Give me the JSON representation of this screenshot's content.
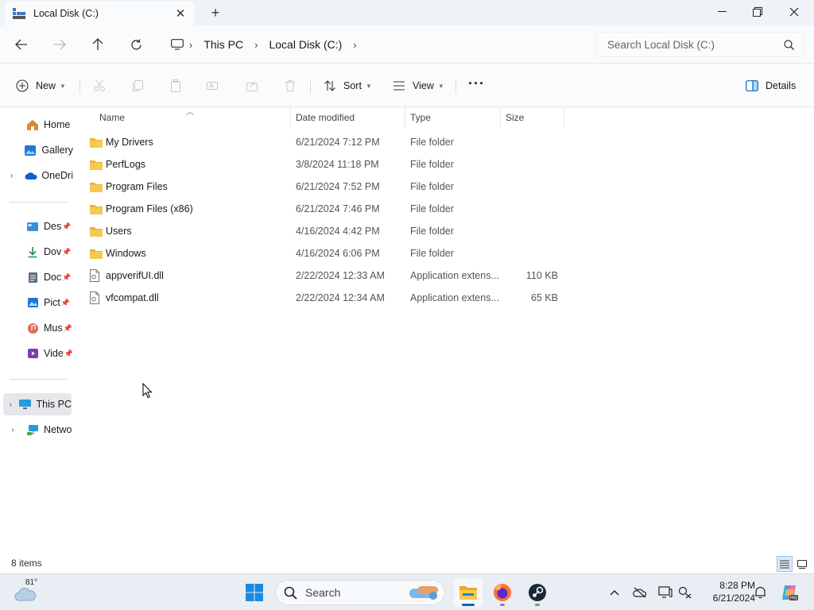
{
  "window": {
    "tab_title": "Local Disk (C:)",
    "new_tab_symbol": "+"
  },
  "address": {
    "crumbs": [
      "This PC",
      "Local Disk (C:)"
    ],
    "search_placeholder": "Search Local Disk (C:)"
  },
  "commands": {
    "new_label": "New",
    "sort_label": "Sort",
    "view_label": "View",
    "more_label": "···",
    "details_label": "Details"
  },
  "nav": {
    "items": [
      {
        "label": "Home",
        "icon": "home-icon"
      },
      {
        "label": "Gallery",
        "icon": "gallery-icon"
      },
      {
        "label": "OneDri",
        "icon": "onedrive-icon"
      },
      {
        "label": "Des",
        "icon": "desktop-icon"
      },
      {
        "label": "Dov",
        "icon": "downloads-icon"
      },
      {
        "label": "Doc",
        "icon": "documents-icon"
      },
      {
        "label": "Pict",
        "icon": "pictures-icon"
      },
      {
        "label": "Mus",
        "icon": "music-icon"
      },
      {
        "label": "Vide",
        "icon": "videos-icon"
      },
      {
        "label": "This PC",
        "icon": "this-pc-icon"
      },
      {
        "label": "Netwo",
        "icon": "network-icon"
      }
    ]
  },
  "columns": {
    "name": "Name",
    "date": "Date modified",
    "type": "Type",
    "size": "Size"
  },
  "files": [
    {
      "name": "My Drivers",
      "date": "6/21/2024 7:12 PM",
      "type": "File folder",
      "size": "",
      "kind": "folder"
    },
    {
      "name": "PerfLogs",
      "date": "3/8/2024 11:18 PM",
      "type": "File folder",
      "size": "",
      "kind": "folder"
    },
    {
      "name": "Program Files",
      "date": "6/21/2024 7:52 PM",
      "type": "File folder",
      "size": "",
      "kind": "folder"
    },
    {
      "name": "Program Files (x86)",
      "date": "6/21/2024 7:46 PM",
      "type": "File folder",
      "size": "",
      "kind": "folder"
    },
    {
      "name": "Users",
      "date": "4/16/2024 4:42 PM",
      "type": "File folder",
      "size": "",
      "kind": "folder"
    },
    {
      "name": "Windows",
      "date": "4/16/2024 6:06 PM",
      "type": "File folder",
      "size": "",
      "kind": "folder"
    },
    {
      "name": "appverifUI.dll",
      "date": "2/22/2024 12:33 AM",
      "type": "Application extens...",
      "size": "110 KB",
      "kind": "dll"
    },
    {
      "name": "vfcompat.dll",
      "date": "2/22/2024 12:34 AM",
      "type": "Application extens...",
      "size": "65 KB",
      "kind": "dll"
    }
  ],
  "status": {
    "item_count": "8 items"
  },
  "taskbar": {
    "temperature": "81°",
    "search_label": "Search",
    "time": "8:28 PM",
    "date": "6/21/2024"
  },
  "colors": {
    "folder": "#f6c342",
    "accent": "#0067c0",
    "selected_nav": "#e5e7ea"
  }
}
